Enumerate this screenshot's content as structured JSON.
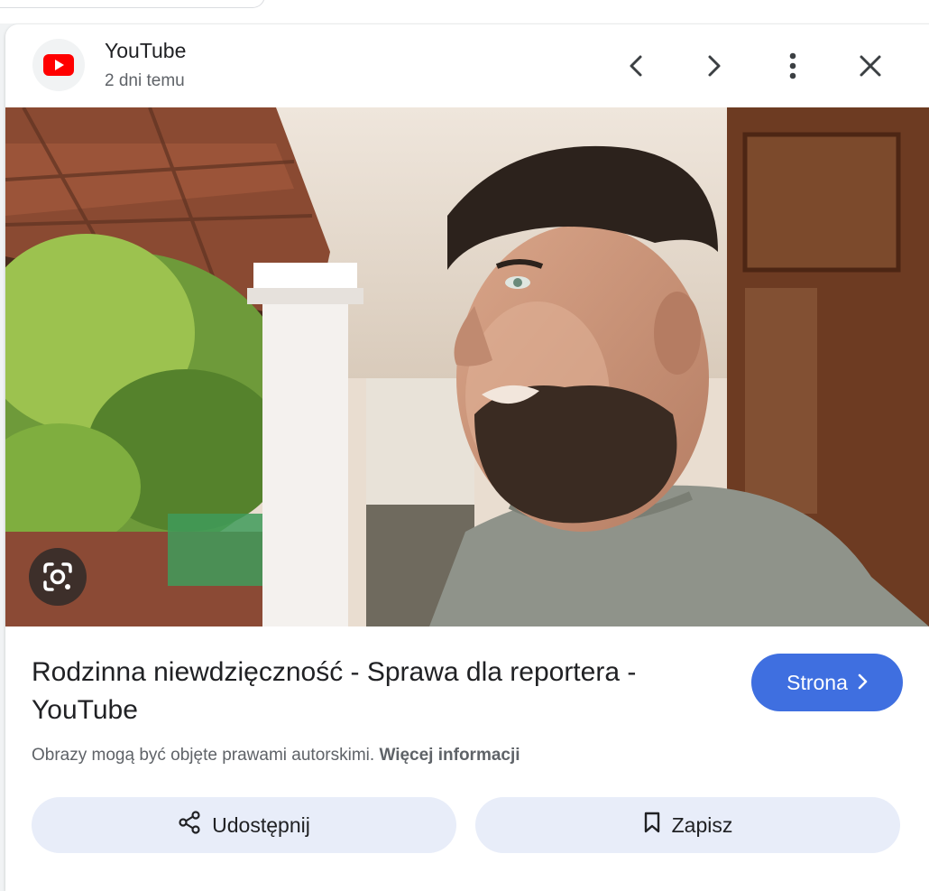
{
  "source": {
    "name": "YouTube",
    "time": "2 dni temu",
    "logo_icon": "youtube-logo",
    "brand_color": "#ff0000"
  },
  "header_icons": [
    "chevron-left-icon",
    "chevron-right-icon",
    "more-vert-icon",
    "close-icon"
  ],
  "image": {
    "lens_icon": "google-lens-icon"
  },
  "result": {
    "title": "Rodzinna niewdzięczność - Sprawa dla reportera - YouTube",
    "visit_label": "Strona",
    "visit_color": "#3f6fe0"
  },
  "copyright": {
    "text": "Obrazy mogą być objęte prawami autorskimi.",
    "link": "Więcej informacji"
  },
  "actions": {
    "share_label": "Udostępnij",
    "save_label": "Zapisz"
  }
}
